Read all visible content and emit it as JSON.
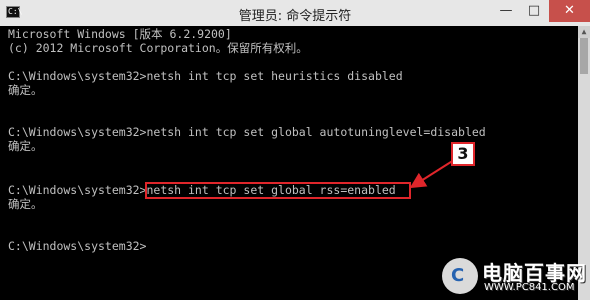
{
  "window": {
    "icon_text": "C:\\",
    "title": "管理员: 命令提示符",
    "minimize_glyph": "—",
    "maximize_glyph": "□",
    "close_glyph": "✕"
  },
  "console": {
    "lines": [
      "Microsoft Windows [版本 6.2.9200]",
      "(c) 2012 Microsoft Corporation。保留所有权利。",
      "",
      "C:\\Windows\\system32>netsh int tcp set heuristics disabled",
      "确定。",
      "",
      "",
      "C:\\Windows\\system32>netsh int tcp set global autotuninglevel=disabled",
      "确定。",
      "",
      "",
      "C:\\Windows\\system32>netsh int tcp set global rss=enabled",
      "确定。",
      "",
      "",
      "C:\\Windows\\system32>"
    ]
  },
  "annotation": {
    "step_number": "3",
    "color": "#e0262b"
  },
  "watermark": {
    "brand": "电脑百事网",
    "url": "WWW.PC841.COM"
  },
  "scrollbar": {
    "up_arrow": "▲"
  }
}
